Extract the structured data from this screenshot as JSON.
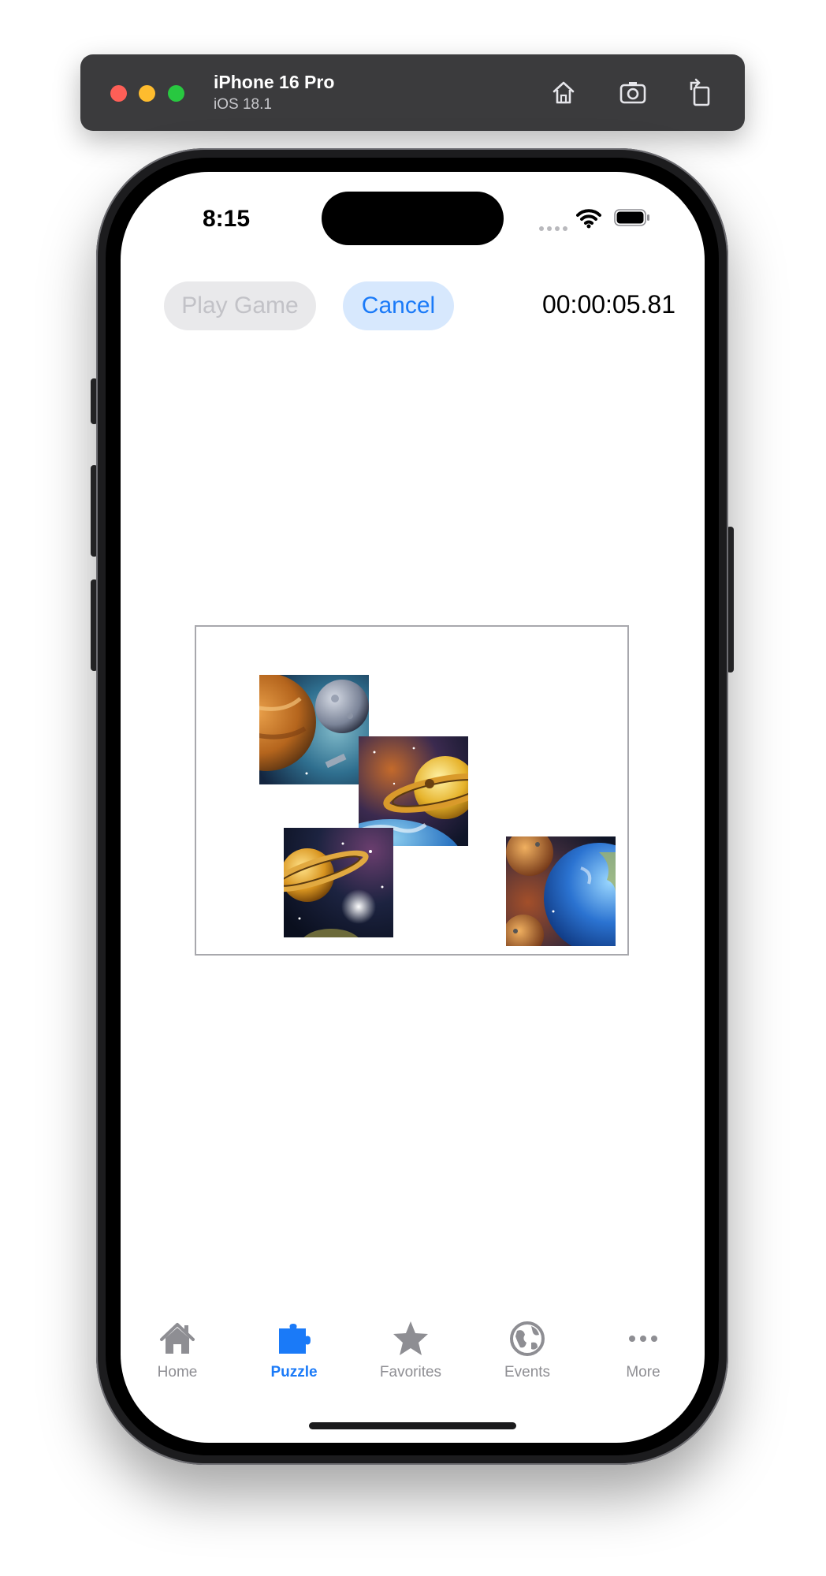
{
  "simulator": {
    "device_name": "iPhone 16 Pro",
    "os_version": "iOS 18.1",
    "buttons": [
      "home-icon",
      "screenshot-icon",
      "rotate-icon"
    ]
  },
  "status_bar": {
    "time": "8:15"
  },
  "toolbar": {
    "play_label": "Play Game",
    "cancel_label": "Cancel",
    "timer": "00:00:05.81"
  },
  "puzzle": {
    "piece_count": 4
  },
  "tabbar": {
    "items": [
      {
        "label": "Home",
        "icon": "house-icon"
      },
      {
        "label": "Puzzle",
        "icon": "puzzle-piece-icon"
      },
      {
        "label": "Favorites",
        "icon": "star-icon"
      },
      {
        "label": "Events",
        "icon": "globe-icon"
      },
      {
        "label": "More",
        "icon": "ellipsis-icon"
      }
    ],
    "active": "Puzzle"
  },
  "colors": {
    "accent": "#1a7af8",
    "cancel_bg": "#d7e8fd",
    "disabled_bg": "#e9e9eb",
    "inactive_tab": "#8e8e93"
  }
}
